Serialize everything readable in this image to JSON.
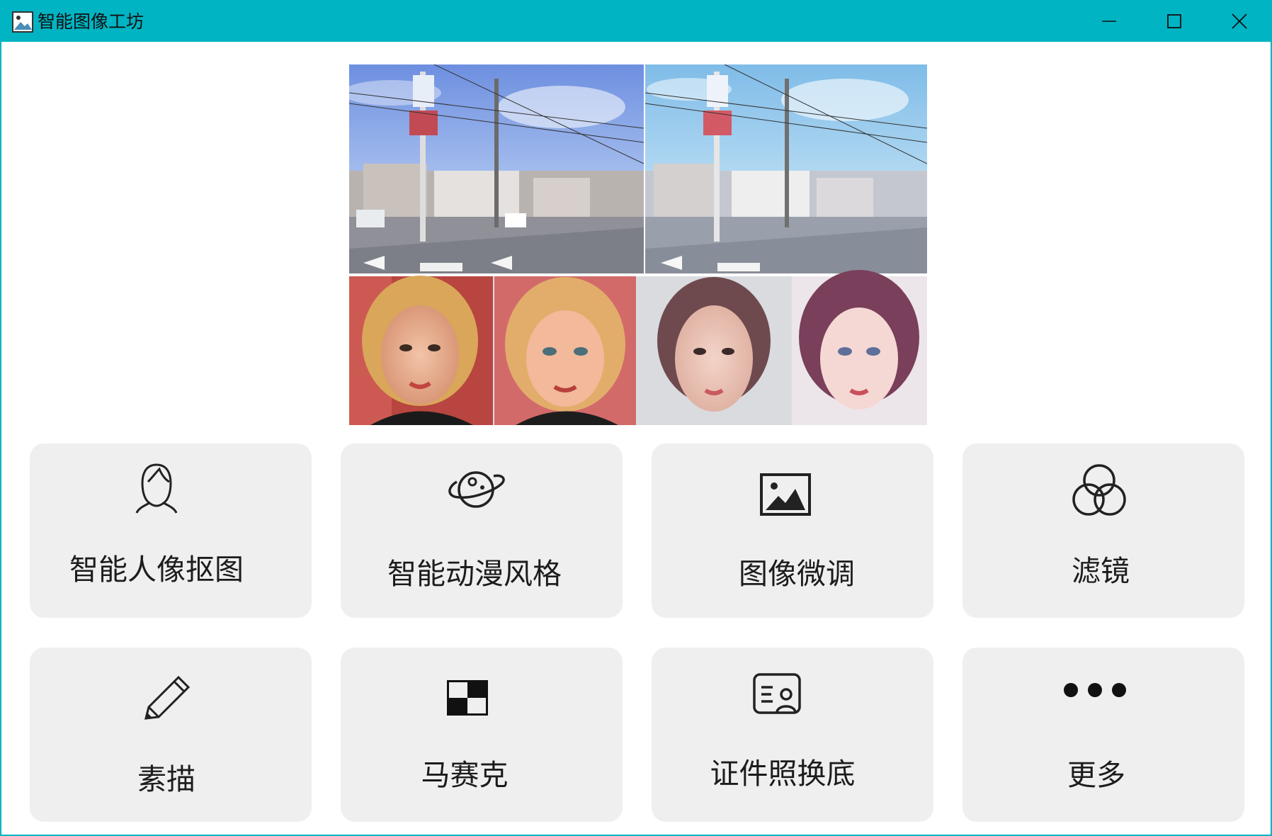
{
  "window": {
    "title": "智能图像工坊",
    "accent_color": "#00b4c3",
    "controls": [
      "minimize-icon",
      "maximize-icon",
      "close-icon"
    ]
  },
  "banner": {
    "description_icon": "example-image"
  },
  "features": [
    {
      "label": "智能人像抠图",
      "icon": "portrait-icon"
    },
    {
      "label": "智能动漫风格",
      "icon": "planet-icon"
    },
    {
      "label": "图像微调",
      "icon": "image-icon"
    },
    {
      "label": "滤镜",
      "icon": "filter-circles-icon"
    },
    {
      "label": "素描",
      "icon": "pencil-icon"
    },
    {
      "label": "马赛克",
      "icon": "mosaic-icon"
    },
    {
      "label": "证件照换底",
      "icon": "id-card-icon"
    },
    {
      "label": "更多",
      "icon": "more-dots-icon"
    }
  ]
}
